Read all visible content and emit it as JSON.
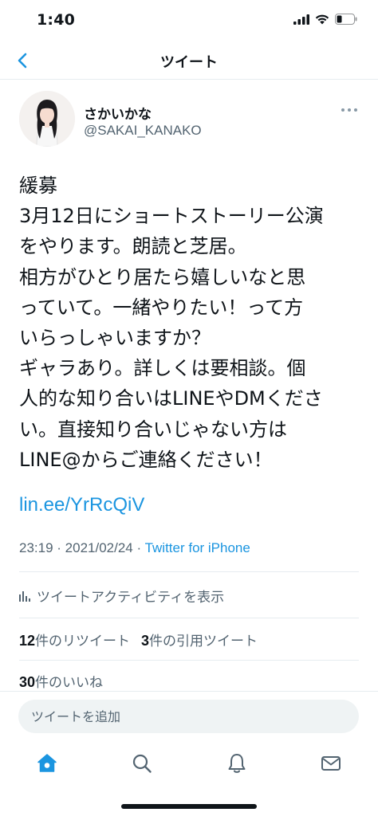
{
  "status_bar": {
    "time": "1:40"
  },
  "nav": {
    "title": "ツイート"
  },
  "author": {
    "display_name": "さかいかな",
    "handle": "@SAKAI_KANAKO"
  },
  "tweet": {
    "text": "緩募\n3月12日にショートストーリー公演\nをやります。朗読と芝居。\n相方がひとり居たら嬉しいなと思\nっていて。一緒やりたい！って方\nいらっしゃいますか？\nギャラあり。詳しくは要相談。個\n人的な知り合いはLINEやDMくださ\nい。直接知り合いじゃない方は\nLINE@からご連絡ください！",
    "link": "lin.ee/YrRcQiV",
    "time": "23:19",
    "date": "2021/02/24",
    "separator": " · ",
    "source": "Twitter for iPhone"
  },
  "activity": {
    "label": "ツイートアクティビティを表示"
  },
  "stats": {
    "retweets": {
      "count": "12",
      "label": "件のリツイート"
    },
    "quotes": {
      "count": "3",
      "label": "件の引用ツイート"
    },
    "likes": {
      "count": "30",
      "label": "件のいいね"
    }
  },
  "reply": {
    "placeholder": "ツイートを追加"
  },
  "tabs": {
    "home": "home-icon",
    "search": "search-icon",
    "notifications": "bell-icon",
    "messages": "mail-icon"
  },
  "colors": {
    "accent": "#1b95e0",
    "text": "#0f1419",
    "secondary": "#536471",
    "divider": "#e6ecf0",
    "input_bg": "#eff3f4"
  }
}
